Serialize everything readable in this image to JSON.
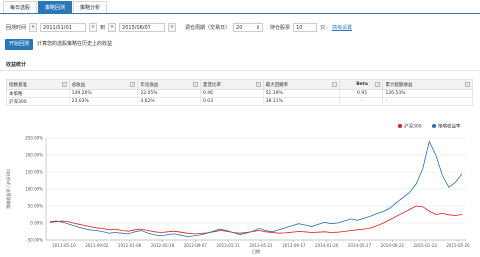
{
  "tabs": [
    "每日选股",
    "策略回测",
    "策略分析"
  ],
  "active_tab": 1,
  "params": {
    "period_label": "回测时间",
    "start_date": "2011/01/01",
    "to_label": "到",
    "end_date": "2015/08/07",
    "rebalance_label": "调仓周期（交易日）",
    "rebalance_value": "20",
    "hold_label": "持仓股票",
    "hold_value": "10",
    "hold_unit": "只",
    "advanced_link": "高级设置"
  },
  "start_button": "开始回测",
  "start_note": "计算您的选股策略在历史上的收益",
  "stats_title": "收益统计",
  "table": {
    "headers": [
      "指数基准",
      "总收益",
      "年化收益",
      "夏普比率",
      "最大回撤率",
      "Beta",
      "累计超额收益"
    ],
    "rows": [
      [
        "本策略",
        "149.26%",
        "22.05%",
        "0.46",
        "51.19%",
        "0.95",
        "126.53%"
      ],
      [
        "沪深300",
        "23.03%",
        "4.62%",
        "0.03",
        "38.11%",
        "-",
        "-"
      ]
    ]
  },
  "chart_data": {
    "type": "line",
    "ylabel": "策略收益率 / 沪深300",
    "xlabel": "日期",
    "ylim": [
      -50,
      250
    ],
    "yticks": [
      "250.00%",
      "200.00%",
      "150.00%",
      "100.00%",
      "50.00%",
      "0.00%",
      "-50.00%"
    ],
    "x_ticks": [
      "2011-05-10",
      "2011-09-02",
      "2012-01-06",
      "2012-05-18",
      "2012-09-07",
      "2013-01-11",
      "2013-05-21",
      "2013-09-17",
      "2014-01-20",
      "2014-05-27",
      "2014-09-22",
      "2015-01-23",
      "2015-05-26"
    ],
    "legend": [
      "沪深300",
      "策略收益率"
    ],
    "legend_position": "top-right",
    "series": [
      {
        "name": "沪深300",
        "color": "#e01a1a",
        "values": [
          2,
          4,
          6,
          3,
          -2,
          -6,
          -10,
          -14,
          -16,
          -20,
          -18,
          -22,
          -24,
          -20,
          -18,
          -22,
          -26,
          -28,
          -26,
          -24,
          -27,
          -30,
          -32,
          -31,
          -29,
          -26,
          -22,
          -24,
          -28,
          -30,
          -28,
          -25,
          -22,
          -26,
          -28,
          -30,
          -29,
          -27,
          -25,
          -26,
          -28,
          -27,
          -26,
          -28,
          -27,
          -25,
          -22,
          -20,
          -18,
          -15,
          -8,
          0,
          10,
          20,
          30,
          40,
          50,
          48,
          35,
          25,
          28,
          24,
          22,
          25
        ]
      },
      {
        "name": "策略收益率",
        "color": "#2a6fb0",
        "values": [
          4,
          6,
          2,
          -4,
          -10,
          -16,
          -20,
          -22,
          -25,
          -30,
          -28,
          -30,
          -32,
          -26,
          -22,
          -30,
          -35,
          -38,
          -34,
          -32,
          -36,
          -40,
          -38,
          -35,
          -30,
          -24,
          -18,
          -22,
          -28,
          -34,
          -30,
          -24,
          -16,
          -22,
          -26,
          -20,
          -14,
          -8,
          -2,
          -6,
          -10,
          -4,
          2,
          -2,
          0,
          6,
          12,
          8,
          14,
          20,
          28,
          34,
          44,
          60,
          75,
          90,
          115,
          160,
          240,
          200,
          140,
          105,
          120,
          145
        ]
      }
    ]
  }
}
